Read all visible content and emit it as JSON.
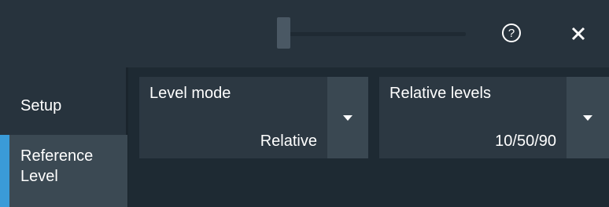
{
  "header": {
    "slider_name": "zoom-slider",
    "help_icon": "help-circle-icon",
    "close_icon": "close-icon"
  },
  "sidebar": {
    "items": [
      {
        "label": "Setup",
        "active": false
      },
      {
        "label": "Reference Level",
        "active": true
      }
    ]
  },
  "fields": [
    {
      "label": "Level mode",
      "value": "Relative"
    },
    {
      "label": "Relative levels",
      "value": "10/50/90"
    }
  ],
  "colors": {
    "accent": "#3a9bd8",
    "background": "#1e2a33",
    "panel": "#27333d",
    "field": "#2c3842",
    "dropdown": "#3a4852"
  }
}
